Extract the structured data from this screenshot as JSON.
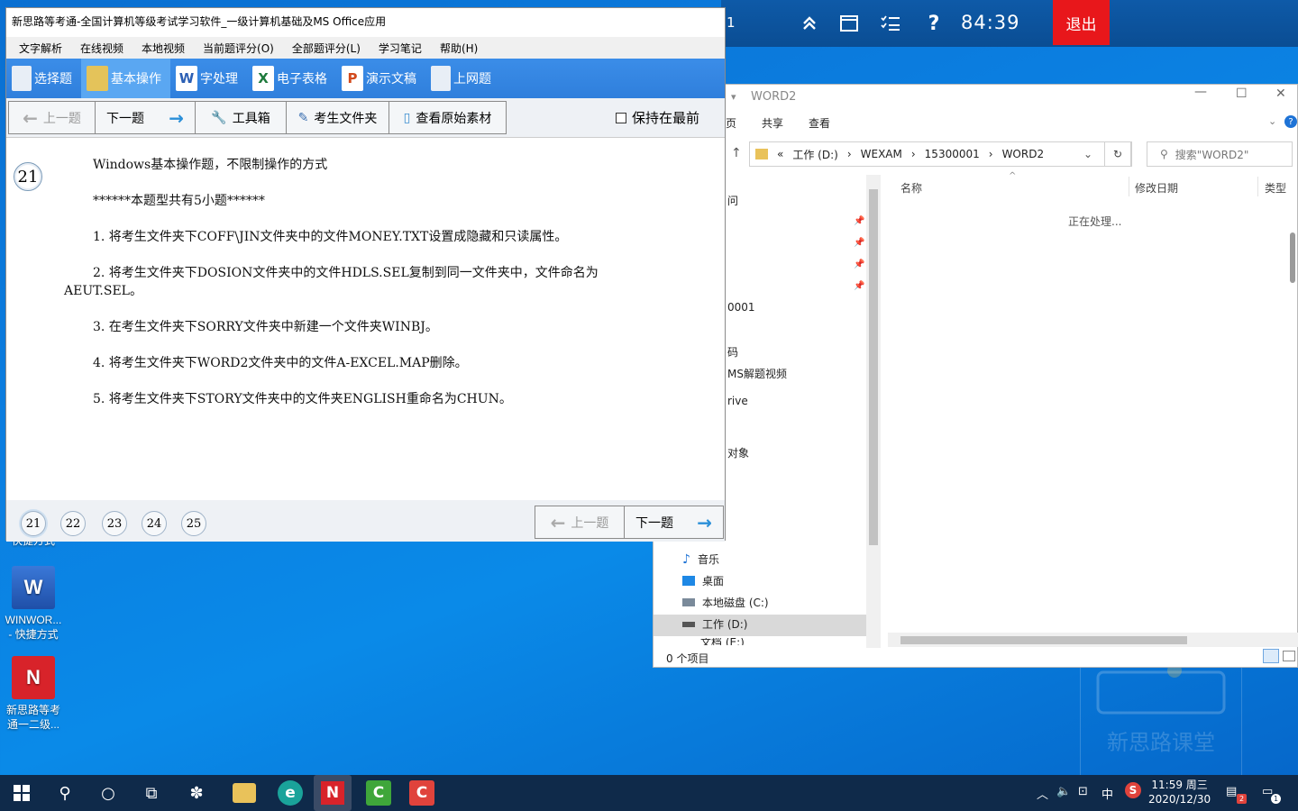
{
  "exam_bar": {
    "partial_number": "1",
    "timer": "84:39",
    "exit_label": "退出",
    "icons": [
      "double-up-icon",
      "window-icon",
      "list-check-icon",
      "help-icon"
    ],
    "help_glyph": "?"
  },
  "explorer": {
    "title": "WORD2",
    "tabs": [
      "页",
      "共享",
      "查看"
    ],
    "address": [
      "«",
      "工作 (D:)",
      "›",
      "WEXAM",
      "›",
      "15300001",
      "›",
      "WORD2"
    ],
    "search_placeholder": "搜索\"WORD2\"",
    "columns": [
      "名称",
      "修改日期",
      "类型"
    ],
    "processing": "正在处理...",
    "nav_items_top": [
      "问",
      "0001",
      "码",
      "MS解题视频",
      "rive",
      "对象"
    ],
    "nav_items": [
      "音乐",
      "桌面",
      "本地磁盘 (C:)",
      "工作 (D:)",
      "文档 (E:)"
    ],
    "status": "0 个项目"
  },
  "app": {
    "title": "新思路等考通-全国计算机等级考试学习软件_一级计算机基础及MS Office应用",
    "menu": [
      "文字解析",
      "在线视频",
      "本地视频",
      "当前题评分(O)",
      "全部题评分(L)",
      "学习笔记",
      "帮助(H)"
    ],
    "categories": [
      "选择题",
      "基本操作",
      "字处理",
      "电子表格",
      "演示文稿",
      "上网题"
    ],
    "toolbar": {
      "prev": "上一题",
      "next": "下一题",
      "tools": "工具箱",
      "exam_folder": "考生文件夹",
      "view_source": "查看原始素材",
      "keep_on_top": "保持在最前"
    },
    "question_number": "21",
    "question": {
      "intro": "Windows基本操作题，不限制操作的方式",
      "count_line": "******本题型共有5小题******",
      "items": [
        "1.  将考生文件夹下COFF\\JIN文件夹中的文件MONEY.TXT设置成隐藏和只读属性。",
        "2.  将考生文件夹下DOSION文件夹中的文件HDLS.SEL复制到同一文件夹中，文件命名为AEUT.SEL。",
        "3.  在考生文件夹下SORRY文件夹中新建一个文件夹WINBJ。",
        "4.  将考生文件夹下WORD2文件夹中的文件A-EXCEL.MAP删除。",
        "5.  将考生文件夹下STORY文件夹中的文件夹ENGLISH重命名为CHUN。"
      ]
    },
    "question_tabs": [
      "21",
      "22",
      "23",
      "24",
      "25"
    ],
    "bottom_prev": "上一题",
    "bottom_next": "下一题"
  },
  "desktop": {
    "icons": [
      {
        "label": "WINWOR...\n- 快捷方式",
        "glyph": "W",
        "color": "#2b5fb4"
      },
      {
        "label": "新思路等考\n通一二级...",
        "glyph": "N",
        "color": "#d8232a"
      }
    ],
    "partial_label": "快捷方式",
    "watermark": "新思路课堂"
  },
  "taskbar": {
    "time": "11:59 周三",
    "date": "2020/12/30",
    "ime": "中",
    "notification_count": "2",
    "action_count": "1",
    "apps": [
      "start-icon",
      "search-icon",
      "cortana-icon",
      "task-view-icon",
      "pinwheel-icon",
      "file-explorer-icon",
      "edge-icon",
      "xinsilu-icon",
      "camtasia-icon",
      "camtasia-red-icon"
    ]
  }
}
